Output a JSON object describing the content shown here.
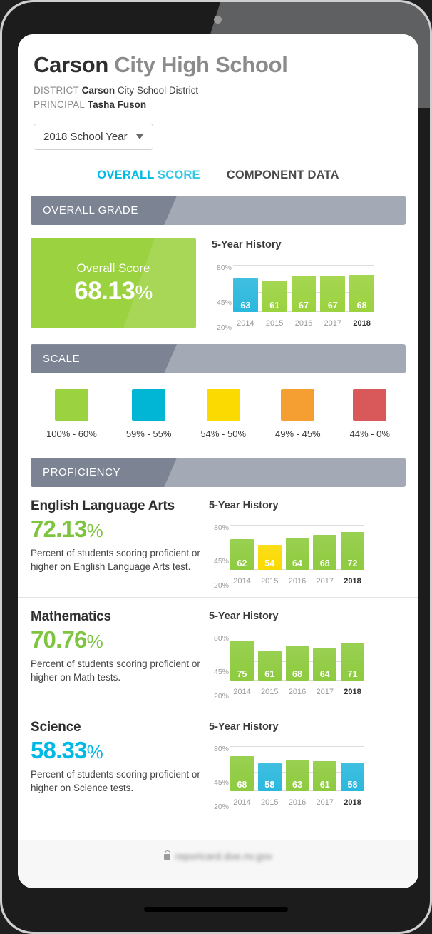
{
  "header": {
    "title_strong": "Carson",
    "title_rest": " City High School",
    "district_label": "DISTRICT",
    "district_strong": "Carson",
    "district_rest": " City School District",
    "principal_label": "PRINCIPAL",
    "principal_value": "Tasha Fuson",
    "year_select_value": "2018 School Year"
  },
  "tabs": {
    "active_word1": "OVERALL",
    "active_word2": "SCORE",
    "inactive": "COMPONENT DATA"
  },
  "overall": {
    "band_label": "OVERALL GRADE",
    "score_label": "Overall Score",
    "score_value": "68.13",
    "score_pct": "%",
    "chart_title": "5-Year History"
  },
  "scale": {
    "band_label": "SCALE",
    "items": [
      {
        "color": "#9bd23f",
        "range": "100% - 60%"
      },
      {
        "color": "#00b6d4",
        "range": "59% - 55%"
      },
      {
        "color": "#fada00",
        "range": "54% - 50%"
      },
      {
        "color": "#f59f33",
        "range": "49% - 45%"
      },
      {
        "color": "#d9595a",
        "range": "44% - 0%"
      }
    ]
  },
  "proficiency": {
    "band_label": "PROFICIENCY",
    "items": [
      {
        "name": "English Language Arts",
        "value": "72.13",
        "pct": "%",
        "value_color": "#7ec440",
        "desc": "Percent of students scoring proficient or higher on English Language Arts test.",
        "chart_title": "5-Year History"
      },
      {
        "name": "Mathematics",
        "value": "70.76",
        "pct": "%",
        "value_color": "#7ec440",
        "desc": "Percent of students scoring proficient or higher on Math tests.",
        "chart_title": "5-Year History"
      },
      {
        "name": "Science",
        "value": "58.33",
        "pct": "%",
        "value_color": "#00b9e4",
        "desc": "Percent of students scoring proficient or higher on Science tests.",
        "chart_title": "5-Year History"
      }
    ]
  },
  "browser": {
    "url": "reportcard.doe.nv.gov",
    "lock_icon": "lock-icon"
  },
  "chart_data": [
    {
      "id": "overall",
      "type": "bar",
      "title": "5-Year History",
      "categories": [
        "2014",
        "2015",
        "2016",
        "2017",
        "2018"
      ],
      "values": [
        63,
        61,
        67,
        67,
        68
      ],
      "colors": [
        "#2bb8dd",
        "#9bd23f",
        "#9bd23f",
        "#9bd23f",
        "#9bd23f"
      ],
      "ytick_labels": [
        "80%",
        "45%",
        "20%"
      ],
      "yticks": [
        80,
        45,
        20
      ],
      "ylim": [
        20,
        88
      ],
      "xlabel": "",
      "ylabel": "",
      "current_category": "2018",
      "grid": true,
      "legend": "none"
    },
    {
      "id": "ela",
      "type": "bar",
      "title": "5-Year History",
      "categories": [
        "2014",
        "2015",
        "2016",
        "2017",
        "2018"
      ],
      "values": [
        62,
        54,
        64,
        68,
        72
      ],
      "colors": [
        "#8ecb3f",
        "#fada00",
        "#8ecb3f",
        "#8ecb3f",
        "#8ecb3f"
      ],
      "ytick_labels": [
        "80%",
        "45%",
        "20%"
      ],
      "yticks": [
        80,
        45,
        20
      ],
      "ylim": [
        20,
        88
      ],
      "xlabel": "",
      "ylabel": "",
      "current_category": "2018",
      "grid": true,
      "legend": "none"
    },
    {
      "id": "math",
      "type": "bar",
      "title": "5-Year History",
      "categories": [
        "2014",
        "2015",
        "2016",
        "2017",
        "2018"
      ],
      "values": [
        75,
        61,
        68,
        64,
        71
      ],
      "colors": [
        "#8ecb3f",
        "#8ecb3f",
        "#8ecb3f",
        "#8ecb3f",
        "#8ecb3f"
      ],
      "ytick_labels": [
        "80%",
        "45%",
        "20%"
      ],
      "yticks": [
        80,
        45,
        20
      ],
      "ylim": [
        20,
        88
      ],
      "xlabel": "",
      "ylabel": "",
      "current_category": "2018",
      "grid": true,
      "legend": "none"
    },
    {
      "id": "science",
      "type": "bar",
      "title": "5-Year History",
      "categories": [
        "2014",
        "2015",
        "2016",
        "2017",
        "2018"
      ],
      "values": [
        68,
        58,
        63,
        61,
        58
      ],
      "colors": [
        "#8ecb3f",
        "#2bb8dd",
        "#8ecb3f",
        "#8ecb3f",
        "#2bb8dd"
      ],
      "ytick_labels": [
        "80%",
        "45%",
        "20%"
      ],
      "yticks": [
        80,
        45,
        20
      ],
      "ylim": [
        20,
        88
      ],
      "xlabel": "",
      "ylabel": "",
      "current_category": "2018",
      "grid": true,
      "legend": "none"
    }
  ]
}
